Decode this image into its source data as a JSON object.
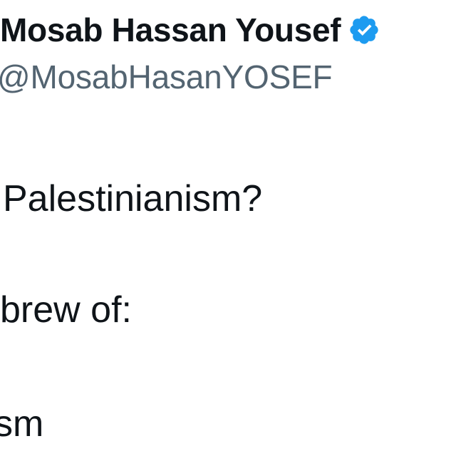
{
  "post": {
    "author": {
      "display_name": "Mosab Hassan Yousef",
      "handle": "@MosabHasanYOSEF",
      "verified": true,
      "verified_icon": "verified-check-icon",
      "verified_color": "#1d9bf0"
    },
    "body_lines": [
      "Palestinianism?",
      "brew of:",
      "sm"
    ]
  }
}
